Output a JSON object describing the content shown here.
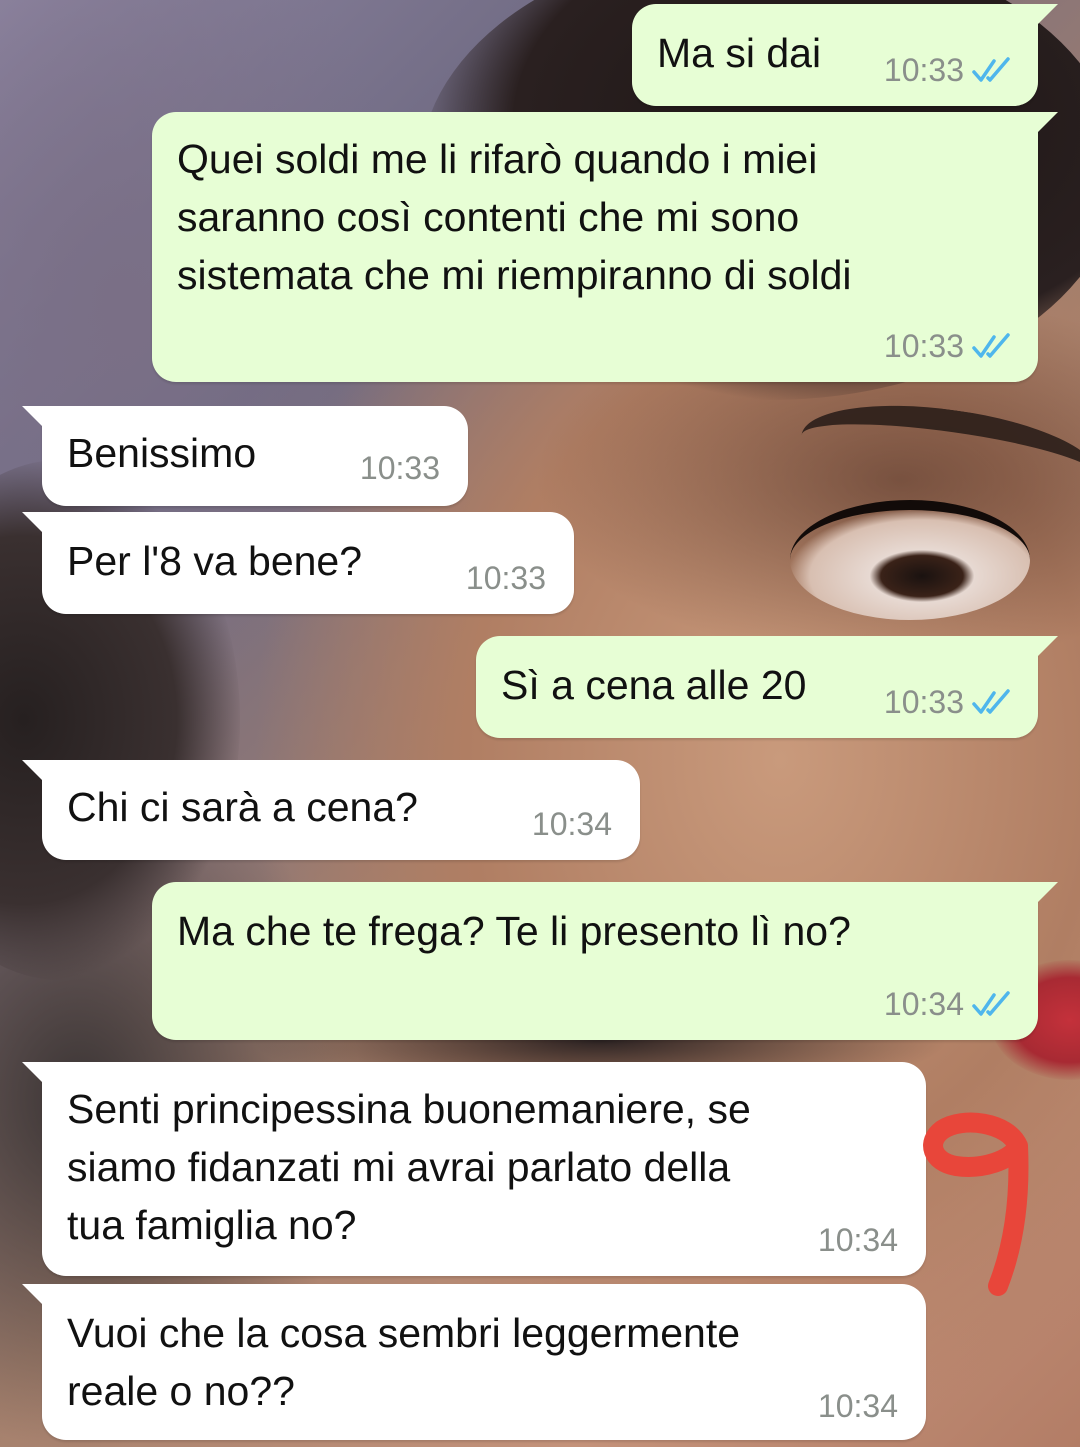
{
  "chat": {
    "messages": [
      {
        "direction": "out",
        "text": "Ma si dai",
        "time": "10:33",
        "status_icon": "double-check-read-icon"
      },
      {
        "direction": "out",
        "text": "Quei soldi me li rifarò quando i miei\nsaranno così contenti che mi sono\nsistemata che mi riempiranno di soldi",
        "time": "10:33",
        "status_icon": "double-check-read-icon"
      },
      {
        "direction": "in",
        "text": "Benissimo",
        "time": "10:33"
      },
      {
        "direction": "in",
        "text": "Per l'8 va bene?",
        "time": "10:33"
      },
      {
        "direction": "out",
        "text": "Sì a cena alle 20",
        "time": "10:33",
        "status_icon": "double-check-read-icon"
      },
      {
        "direction": "in",
        "text": "Chi ci sarà a cena?",
        "time": "10:34"
      },
      {
        "direction": "out",
        "text": "Ma che te frega? Te li presento lì no?",
        "time": "10:34",
        "status_icon": "double-check-read-icon"
      },
      {
        "direction": "in",
        "text": "Senti principessina buonemaniere, se\nsiamo fidanzati mi avrai parlato della\ntua famiglia no?",
        "time": "10:34"
      },
      {
        "direction": "in",
        "text": "Vuoi che la cosa sembri leggermente\nreale o no??",
        "time": "10:34"
      }
    ]
  },
  "colors": {
    "outgoing_bubble": "#e7fed5",
    "incoming_bubble": "#ffffff",
    "read_ticks": "#4fb6ec",
    "timestamp": "#8a8f8b",
    "annotation": "#e8463a"
  },
  "annotation": {
    "icon": "handwritten-number-9",
    "shape": "9"
  }
}
